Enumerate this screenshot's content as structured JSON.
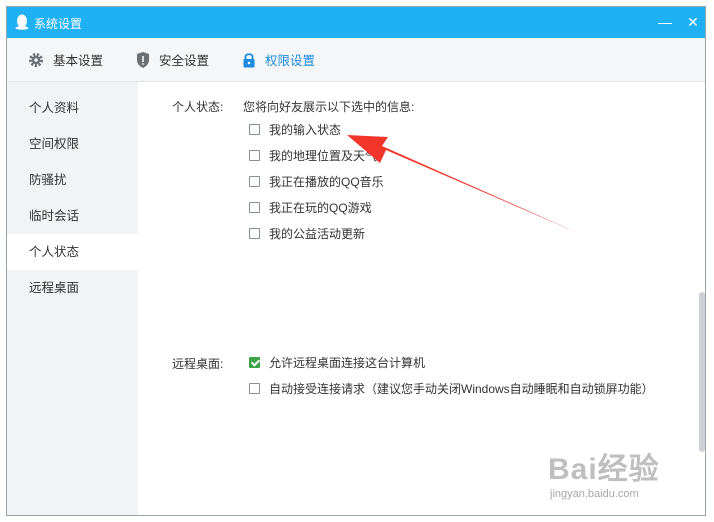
{
  "window": {
    "title": "系统设置",
    "minimize_glyph": "—",
    "close_glyph": "✕"
  },
  "tabs": [
    {
      "label": "基本设置",
      "icon": "gear-icon"
    },
    {
      "label": "安全设置",
      "icon": "shield-icon"
    },
    {
      "label": "权限设置",
      "icon": "lock-icon",
      "active": true
    }
  ],
  "sidebar": {
    "items": [
      {
        "label": "个人资料"
      },
      {
        "label": "空间权限"
      },
      {
        "label": "防骚扰"
      },
      {
        "label": "临时会话"
      },
      {
        "label": "个人状态",
        "active": true
      },
      {
        "label": "远程桌面"
      }
    ]
  },
  "status_section": {
    "label": "个人状态:",
    "description": "您将向好友展示以下选中的信息:",
    "options": [
      {
        "label": "我的输入状态",
        "checked": false
      },
      {
        "label": "我的地理位置及天气",
        "checked": false
      },
      {
        "label": "我正在播放的QQ音乐",
        "checked": false
      },
      {
        "label": "我正在玩的QQ游戏",
        "checked": false
      },
      {
        "label": "我的公益活动更新",
        "checked": false
      }
    ]
  },
  "remote_section": {
    "label": "远程桌面:",
    "options": [
      {
        "label": "允许远程桌面连接这台计算机",
        "checked": true
      },
      {
        "label": "自动接受连接请求（建议您手动关闭Windows自动睡眠和自动锁屏功能）",
        "checked": false
      }
    ]
  },
  "watermark": {
    "brand": "Bai经验",
    "url": "jingyan.baidu.com"
  },
  "colors": {
    "titlebar": "#1fb1f4",
    "active_tab_text": "#1a8be0",
    "checked_box": "#3da347",
    "annotation_arrow": "#f2352a"
  }
}
